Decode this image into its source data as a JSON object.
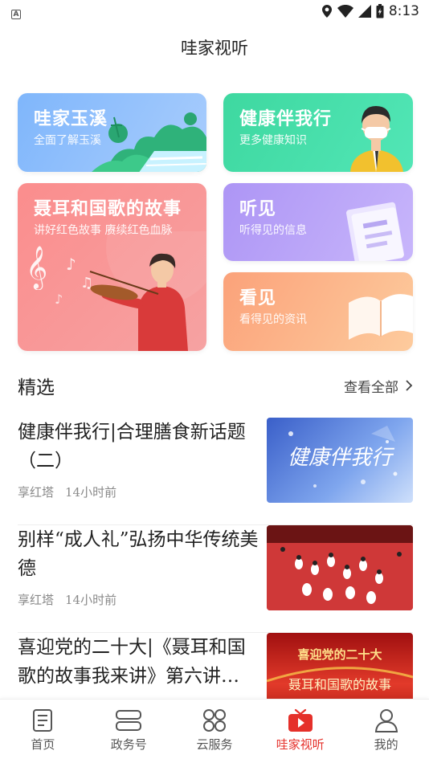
{
  "status_bar": {
    "left_icon": "A",
    "time": "8:13"
  },
  "header": {
    "title": "哇家视听"
  },
  "cards": {
    "yuxi": {
      "title": "哇家玉溪",
      "subtitle": "全面了解玉溪"
    },
    "health": {
      "title": "健康伴我行",
      "subtitle": "更多健康知识"
    },
    "anthem": {
      "title": "聂耳和国歌的故事",
      "subtitle": "讲好红色故事  赓续红色血脉"
    },
    "listen": {
      "title": "听见",
      "subtitle": "听得见的信息"
    },
    "watch": {
      "title": "看见",
      "subtitle": "看得见的资讯"
    }
  },
  "section": {
    "title": "精选",
    "see_all": "查看全部"
  },
  "news": [
    {
      "headline": "健康伴我行|合理膳食新话题（二）",
      "source": "享红塔",
      "time": "14小时前",
      "thumb_text": "健康伴我行"
    },
    {
      "headline": "别样“成人礼”弘扬中华传统美德",
      "source": "享红塔",
      "time": "14小时前"
    },
    {
      "headline": "喜迎党的二十大|《聂耳和国歌的故事我来讲》第六讲…",
      "source": "",
      "time": "",
      "thumb_text_top": "喜迎党的二十大",
      "thumb_text_bottom": "聂耳和国歌的故事"
    }
  ],
  "bottom_nav": [
    {
      "label": "首页",
      "icon": "home-icon"
    },
    {
      "label": "政务号",
      "icon": "government-icon"
    },
    {
      "label": "云服务",
      "icon": "cloud-service-icon"
    },
    {
      "label": "哇家视听",
      "icon": "tv-icon",
      "active": true
    },
    {
      "label": "我的",
      "icon": "profile-icon"
    }
  ],
  "colors": {
    "accent": "#e5302a"
  }
}
